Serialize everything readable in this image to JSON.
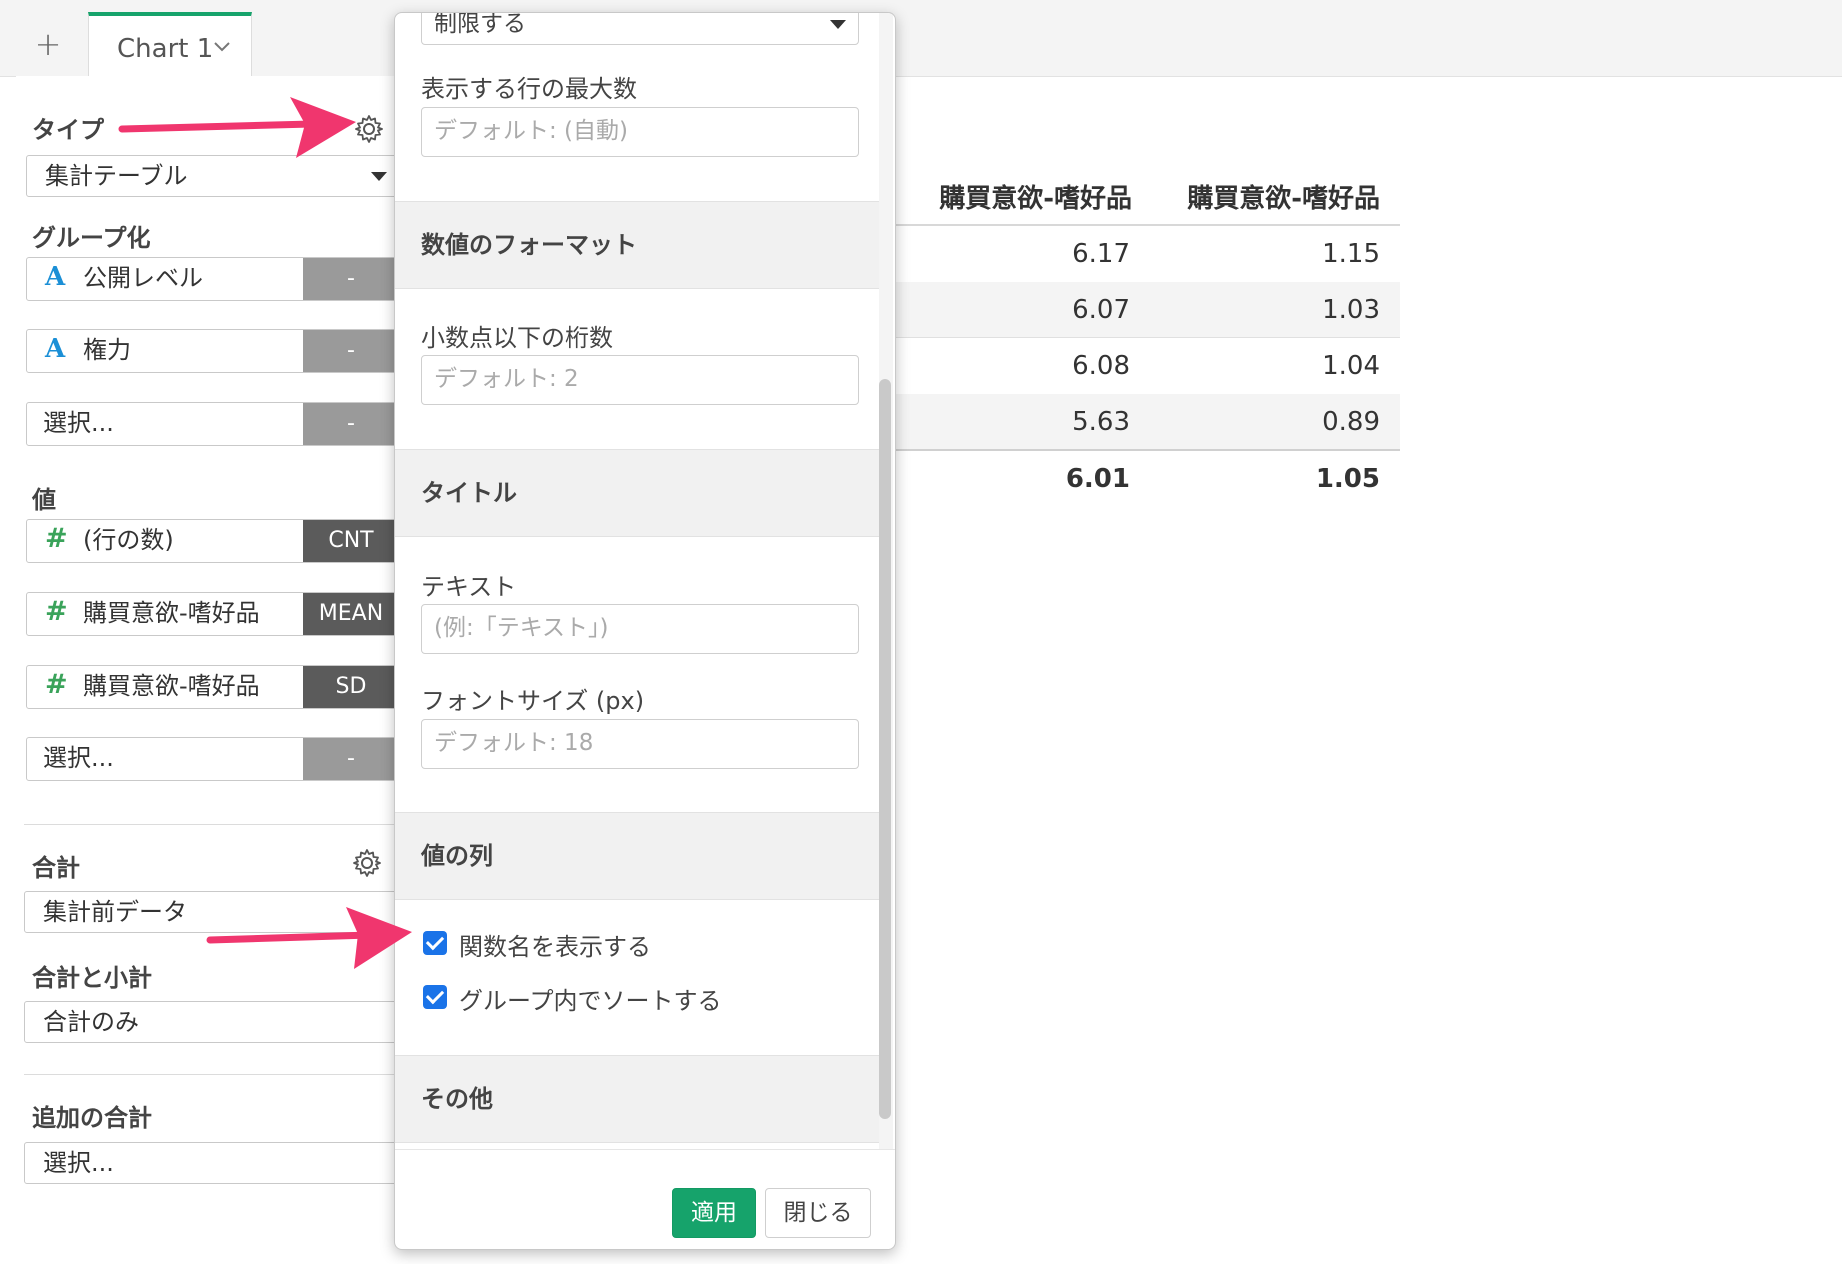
{
  "tabs": {
    "add": "+",
    "chart_tab": "Chart 1"
  },
  "left": {
    "type_label": "タイプ",
    "type_value": "集計テーブル",
    "group_label": "グループ化",
    "group_items": [
      {
        "text": "公開レベル",
        "btn": "-"
      },
      {
        "text": "権力",
        "btn": "-"
      },
      {
        "text": "選択...",
        "btn": "-"
      }
    ],
    "value_label": "値",
    "value_items": [
      {
        "text": "(行の数)",
        "btn": "CNT"
      },
      {
        "text": "購買意欲-嗜好品",
        "btn": "MEAN"
      },
      {
        "text": "購買意欲-嗜好品",
        "btn": "SD"
      },
      {
        "text": "選択...",
        "btn": "-"
      }
    ],
    "total_label": "合計",
    "total_value": "集計前データ",
    "subtotal_label": "合計と小計",
    "subtotal_value": "合計のみ",
    "extra_label": "追加の合計",
    "extra_value": "選択..."
  },
  "table": {
    "headers": [
      "購買意欲-嗜好品",
      "購買意欲-嗜好品"
    ],
    "rows": [
      [
        "6.17",
        "1.15"
      ],
      [
        "6.07",
        "1.03"
      ],
      [
        "6.08",
        "1.04"
      ],
      [
        "5.63",
        "0.89"
      ]
    ],
    "total": [
      "6.01",
      "1.05"
    ]
  },
  "popup": {
    "top_select": "制限する",
    "max_rows_label": "表示する行の最大数",
    "max_rows_placeholder": "デフォルト: (自動)",
    "format_section": "数値のフォーマット",
    "decimals_label": "小数点以下の桁数",
    "decimals_placeholder": "デフォルト: 2",
    "title_section": "タイトル",
    "text_label": "テキスト",
    "text_placeholder": "(例:「テキスト」)",
    "font_label": "フォントサイズ (px)",
    "font_placeholder": "デフォルト: 18",
    "values_section": "値の列",
    "check1": "関数名を表示する",
    "check2": "グループ内でソートする",
    "other_section": "その他",
    "apply": "適用",
    "close": "閉じる"
  },
  "colors": {
    "accent": "#16a36b",
    "checkbox": "#1a73e8",
    "annotation_arrow": "#f0366e"
  }
}
